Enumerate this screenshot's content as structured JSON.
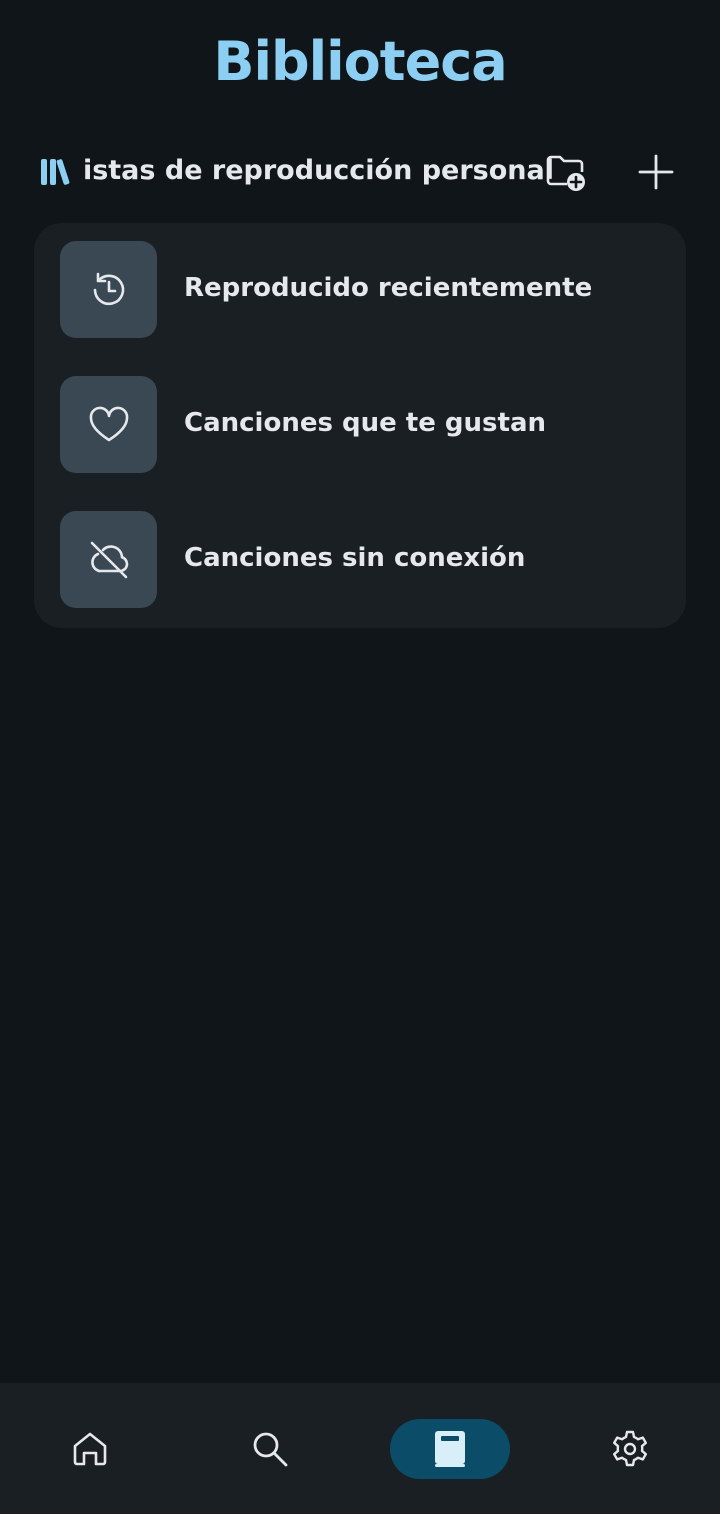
{
  "header": {
    "title": "Biblioteca"
  },
  "section": {
    "icon": "library-icon",
    "label": "Listas de reproducción personal",
    "actions": {
      "new_folder_icon": "folder-add-icon",
      "add_icon": "plus-icon"
    }
  },
  "items": [
    {
      "label": "Reproducido recientemente",
      "icon": "history-icon"
    },
    {
      "label": "Canciones que te gustan",
      "icon": "heart-icon"
    },
    {
      "label": "Canciones sin conexión",
      "icon": "cloud-off-icon"
    }
  ],
  "bottom_nav": [
    {
      "name": "home",
      "icon": "home-icon",
      "active": false
    },
    {
      "name": "search",
      "icon": "search-icon",
      "active": false
    },
    {
      "name": "library",
      "icon": "book-icon",
      "active": true
    },
    {
      "name": "settings",
      "icon": "gear-icon",
      "active": false
    }
  ],
  "colors": {
    "background": "#101519",
    "surface": "#1a1f23",
    "accent": "#8ccff3",
    "thumb": "#3a4854",
    "active_nav": "#0b4d68",
    "text": "#e6e9ec"
  }
}
